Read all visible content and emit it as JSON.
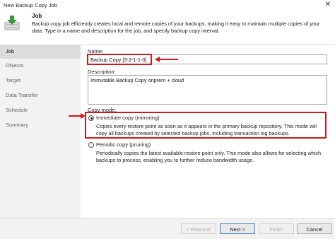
{
  "window": {
    "title": "New Backup Copy Job",
    "close_glyph": "✕"
  },
  "header": {
    "title": "Job",
    "description": "Backup copy job efficiently creates local and remote copies of your backups, making it easy to maintain multiple copies of your data. Type in a name and description for the job, and specify backup copy interval.",
    "icon": "backup-copy-icon"
  },
  "sidebar": {
    "items": [
      {
        "label": "Job",
        "active": true
      },
      {
        "label": "Objects"
      },
      {
        "label": "Target"
      },
      {
        "label": "Data Transfer"
      },
      {
        "label": "Schedule"
      },
      {
        "label": "Summary"
      }
    ]
  },
  "form": {
    "name_label": "Name:",
    "name_value": "Backup Copy [3-2-1-1-0]",
    "description_label": "Description:",
    "description_value": "Immutable Backup Copy onprem + cloud",
    "copy_mode_label": "Copy mode:",
    "immediate_label": "Immediate copy (mirroring)",
    "immediate_desc": "Copies every restore point as soon as it appears in the primary backup repository. This mode will copy all backups created by selected backup jobs, including transaction log backups.",
    "periodic_label": "Periodic copy (pruning)",
    "periodic_desc": "Periodically copies the latest available restore point only. This mode also allows for selecting which backups to process, enabling you to further reduce bandwidth usage."
  },
  "footer": {
    "previous": "< Previous",
    "next": "Next >",
    "finish": "Finish",
    "cancel": "Cancel"
  },
  "colors": {
    "highlight_red": "#d01a1a",
    "accent": "#3c7fd6",
    "icon_green": "#3b9a3b"
  }
}
